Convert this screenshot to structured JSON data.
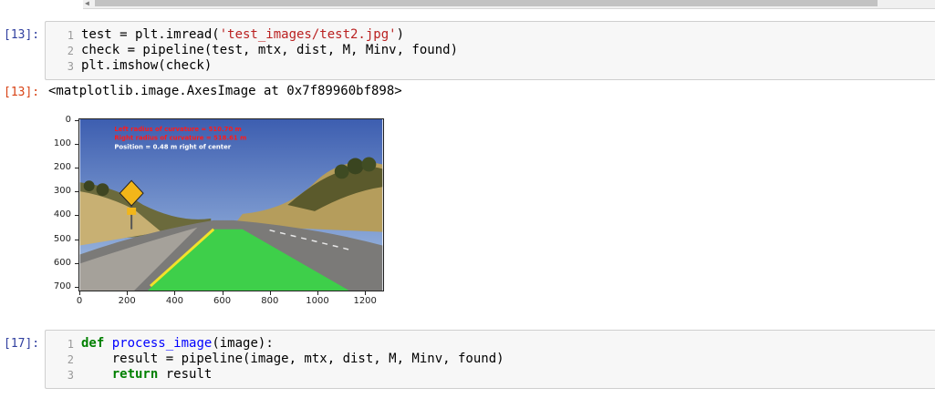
{
  "cells": [
    {
      "prompt": "[13]:",
      "lines": [
        {
          "num": "1",
          "parts": [
            [
              "",
              "test = plt.imread("
            ],
            [
              "str",
              "'test_images/test2.jpg'"
            ],
            [
              "",
              ")"
            ]
          ]
        },
        {
          "num": "2",
          "parts": [
            [
              "",
              "check = pipeline(test, mtx, dist, M, Minv, found)"
            ]
          ]
        },
        {
          "num": "3",
          "parts": [
            [
              "",
              "plt.imshow(check)"
            ]
          ]
        }
      ]
    },
    {
      "prompt": "[17]:",
      "lines": [
        {
          "num": "1",
          "parts": [
            [
              "kw",
              "def"
            ],
            [
              "",
              " "
            ],
            [
              "fn",
              "process_image"
            ],
            [
              "",
              "(image):"
            ]
          ]
        },
        {
          "num": "2",
          "parts": [
            [
              "",
              "    result = pipeline(image, mtx, dist, M, Minv, found)"
            ]
          ]
        },
        {
          "num": "3",
          "parts": [
            [
              "",
              "    "
            ],
            [
              "kw",
              "return"
            ],
            [
              "",
              " result"
            ]
          ]
        }
      ]
    }
  ],
  "output": {
    "prompt": "[13]:",
    "text": "<matplotlib.image.AxesImage at 0x7f89960bf898>"
  },
  "plot": {
    "y_ticks": [
      "0",
      "100",
      "200",
      "300",
      "400",
      "500",
      "600",
      "700"
    ],
    "x_ticks": [
      "0",
      "200",
      "400",
      "600",
      "800",
      "1000",
      "1200"
    ],
    "overlay": {
      "left_radius": "Left radius of curvature  = 510.70 m",
      "right_radius": "Right radius of curvature = 518.61 m",
      "position": "Position = 0.48 m right of center"
    },
    "colors": {
      "overlay_red": "#ff1a1a",
      "overlay_white": "#ffffff",
      "lane_fill": "#3ecf4a",
      "lane_line": "#f2e22a",
      "sky_top": "#3d5eb0",
      "sky_bottom": "#a9c4e6"
    }
  }
}
